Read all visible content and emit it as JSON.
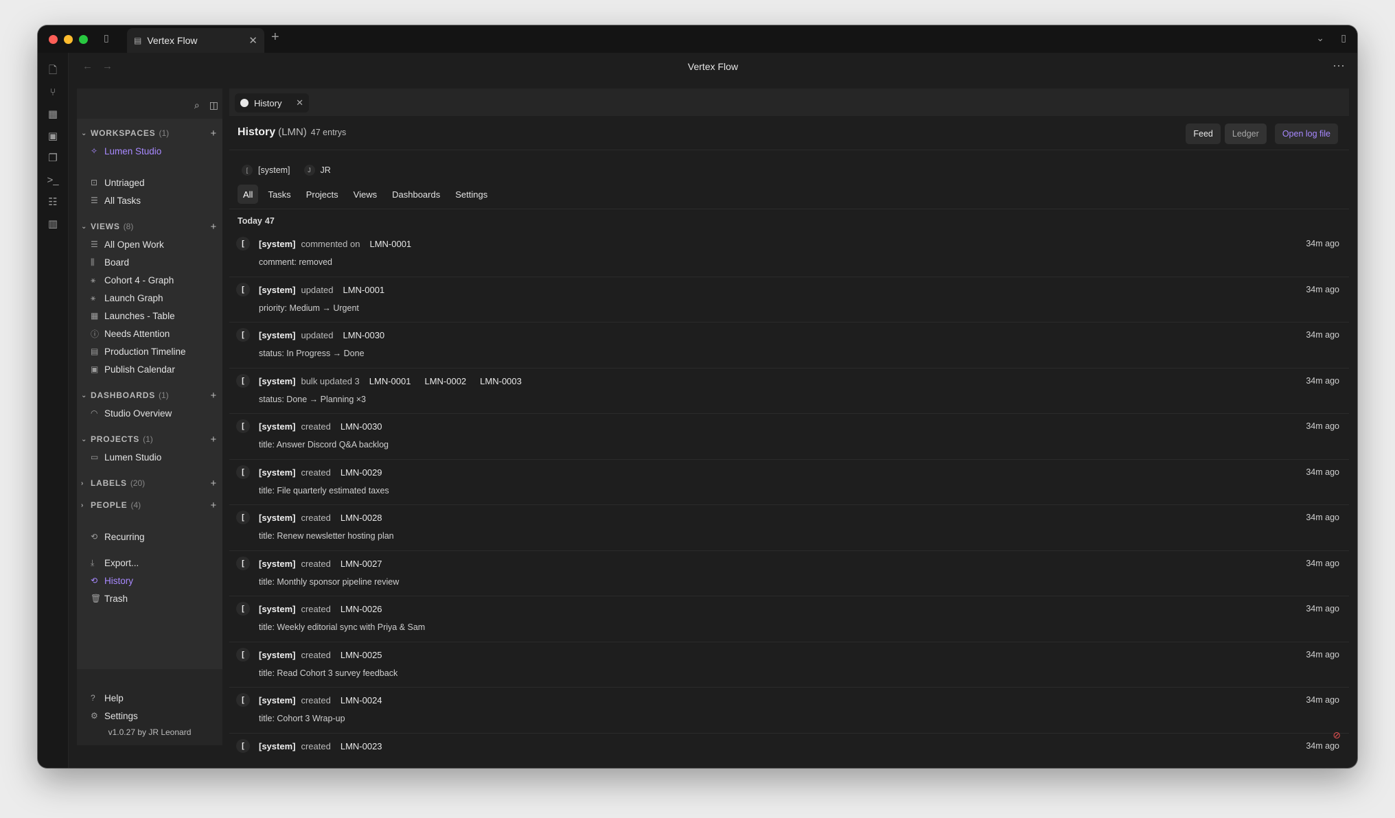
{
  "window": {
    "tab_title": "Vertex Flow",
    "title": "Vertex Flow"
  },
  "sidebar": {
    "sections": {
      "workspaces": {
        "label": "WORKSPACES",
        "count": "(1)"
      },
      "views": {
        "label": "VIEWS",
        "count": "(8)"
      },
      "dashboards": {
        "label": "DASHBOARDS",
        "count": "(1)"
      },
      "projects": {
        "label": "PROJECTS",
        "count": "(1)"
      },
      "labels": {
        "label": "LABELS",
        "count": "(20)"
      },
      "people": {
        "label": "PEOPLE",
        "count": "(4)"
      }
    },
    "workspace": "Lumen Studio",
    "untriaged": "Untriaged",
    "all_tasks": "All Tasks",
    "views": [
      "All Open Work",
      "Board",
      "Cohort 4 - Graph",
      "Launch Graph",
      "Launches - Table",
      "Needs Attention",
      "Production Timeline",
      "Publish Calendar"
    ],
    "dashboard": "Studio Overview",
    "project": "Lumen Studio",
    "recurring": "Recurring",
    "export": "Export...",
    "history": "History",
    "trash": "Trash",
    "help": "Help",
    "settings": "Settings",
    "version": "v1.0.27 by JR Leonard"
  },
  "main": {
    "tab_label": "History",
    "title": "History",
    "subtitle": "(LMN)",
    "entry_count": "47 entrys",
    "buttons": {
      "feed": "Feed",
      "ledger": "Ledger",
      "open_log": "Open log file"
    },
    "actors": [
      {
        "initial": "[",
        "name": "[system]"
      },
      {
        "initial": "J",
        "name": "JR"
      }
    ],
    "filters": [
      "All",
      "Tasks",
      "Projects",
      "Views",
      "Dashboards",
      "Settings"
    ],
    "group": {
      "label": "Today",
      "count": "47"
    },
    "entries": [
      {
        "actor": "[system]",
        "verb": "commented on",
        "refs": [
          "LMN-0001"
        ],
        "detail": "comment: removed",
        "time": "34m ago"
      },
      {
        "actor": "[system]",
        "verb": "updated",
        "refs": [
          "LMN-0001"
        ],
        "detail": "priority: Medium → Urgent",
        "time": "34m ago"
      },
      {
        "actor": "[system]",
        "verb": "updated",
        "refs": [
          "LMN-0030"
        ],
        "detail": "status: In Progress → Done",
        "time": "34m ago"
      },
      {
        "actor": "[system]",
        "verb": "bulk updated 3",
        "refs": [
          "LMN-0001",
          "LMN-0002",
          "LMN-0003"
        ],
        "detail": "status: Done → Planning ×3",
        "time": "34m ago"
      },
      {
        "actor": "[system]",
        "verb": "created",
        "refs": [
          "LMN-0030"
        ],
        "detail": "title: Answer Discord Q&A backlog",
        "time": "34m ago"
      },
      {
        "actor": "[system]",
        "verb": "created",
        "refs": [
          "LMN-0029"
        ],
        "detail": "title: File quarterly estimated taxes",
        "time": "34m ago"
      },
      {
        "actor": "[system]",
        "verb": "created",
        "refs": [
          "LMN-0028"
        ],
        "detail": "title: Renew newsletter hosting plan",
        "time": "34m ago"
      },
      {
        "actor": "[system]",
        "verb": "created",
        "refs": [
          "LMN-0027"
        ],
        "detail": "title: Monthly sponsor pipeline review",
        "time": "34m ago"
      },
      {
        "actor": "[system]",
        "verb": "created",
        "refs": [
          "LMN-0026"
        ],
        "detail": "title: Weekly editorial sync with Priya & Sam",
        "time": "34m ago"
      },
      {
        "actor": "[system]",
        "verb": "created",
        "refs": [
          "LMN-0025"
        ],
        "detail": "title: Read Cohort 3 survey feedback",
        "time": "34m ago"
      },
      {
        "actor": "[system]",
        "verb": "created",
        "refs": [
          "LMN-0024"
        ],
        "detail": "title: Cohort 3 Wrap-up",
        "time": "34m ago"
      },
      {
        "actor": "[system]",
        "verb": "created",
        "refs": [
          "LMN-0023"
        ],
        "detail": "",
        "time": "34m ago"
      }
    ]
  }
}
